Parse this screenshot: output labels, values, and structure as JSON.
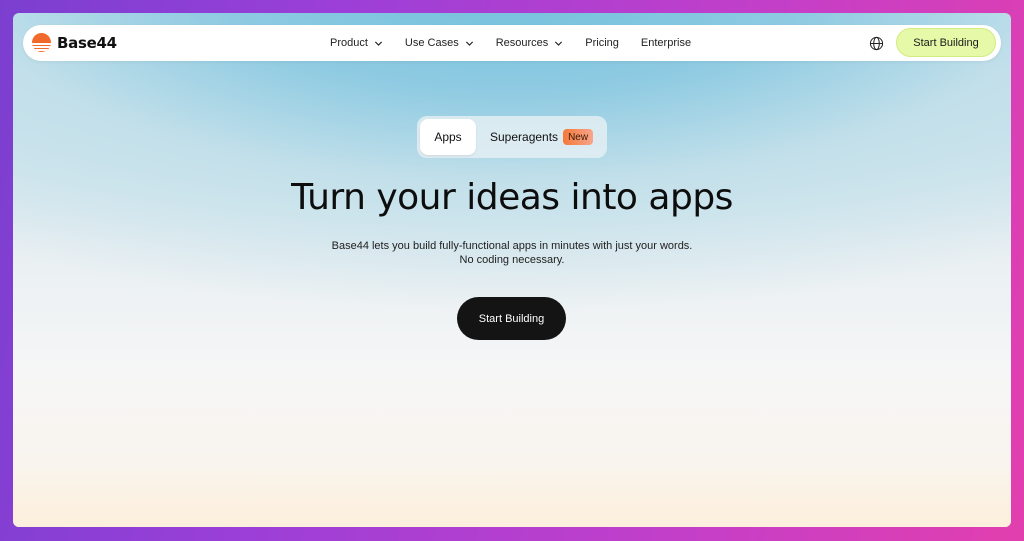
{
  "brand": {
    "name": "Base44",
    "color": "#f26a2b"
  },
  "nav": {
    "items": [
      {
        "label": "Product",
        "has_dropdown": true
      },
      {
        "label": "Use Cases",
        "has_dropdown": true
      },
      {
        "label": "Resources",
        "has_dropdown": true
      },
      {
        "label": "Pricing",
        "has_dropdown": false
      },
      {
        "label": "Enterprise",
        "has_dropdown": false
      }
    ],
    "language_icon": "globe-icon",
    "cta_label": "Start Building",
    "cta_color": "#e6f9a8"
  },
  "hero": {
    "tabs": [
      {
        "label": "Apps",
        "selected": true
      },
      {
        "label": "Superagents",
        "selected": false,
        "badge": "New"
      }
    ],
    "title": "Turn your ideas into apps",
    "subtitle_line1": "Base44 lets you build fully-functional apps in minutes with just your words.",
    "subtitle_line2": "No coding necessary.",
    "cta_label": "Start Building",
    "cta_color": "#141414"
  }
}
